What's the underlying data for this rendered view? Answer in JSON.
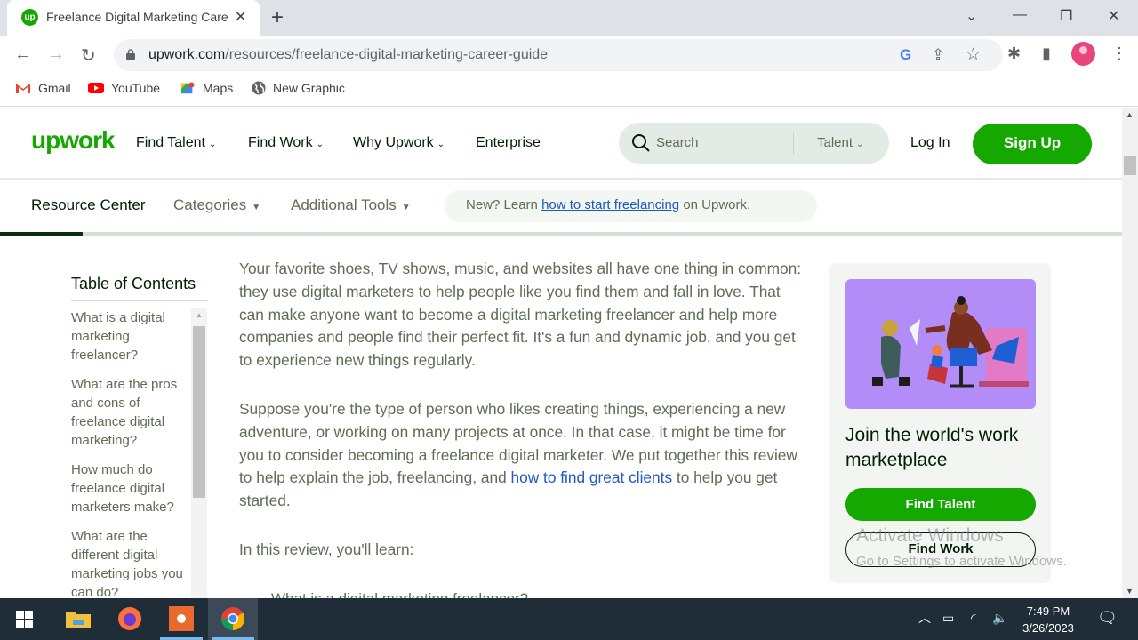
{
  "browser": {
    "tab": {
      "title": "Freelance Digital Marketing Care",
      "favicon": "up",
      "close": "✕"
    },
    "new_tab": "+",
    "window_controls": {
      "tab_search": "⌄",
      "minimize": "—",
      "restore": "❐",
      "close": "✕"
    },
    "url_host": "upwork.com",
    "url_path": "/resources/freelance-digital-marketing-career-guide",
    "nav": {
      "back": "←",
      "forward": "→",
      "reload": "↻"
    },
    "omnibox_icons": {
      "google": "G",
      "share": "⇪",
      "bookmark": "☆"
    },
    "toolbar_icons": {
      "extensions": "✱",
      "side_panel": "▮",
      "menu": "⋮"
    },
    "bookmarks": [
      {
        "label": "Gmail",
        "icon": "gmail-icon"
      },
      {
        "label": "YouTube",
        "icon": "youtube-icon"
      },
      {
        "label": "Maps",
        "icon": "maps-icon"
      },
      {
        "label": "New Graphic",
        "icon": "globe-icon"
      }
    ]
  },
  "header": {
    "logo": "upwork",
    "nav": [
      {
        "label": "Find Talent",
        "dropdown": true
      },
      {
        "label": "Find Work",
        "dropdown": true
      },
      {
        "label": "Why Upwork",
        "dropdown": true
      },
      {
        "label": "Enterprise",
        "dropdown": false
      }
    ],
    "search": {
      "placeholder": "Search",
      "scope": "Talent"
    },
    "login": "Log In",
    "signup": "Sign Up"
  },
  "subnav": {
    "resource_center": "Resource Center",
    "categories": "Categories",
    "additional_tools": "Additional Tools",
    "promo_prefix": "New? Learn ",
    "promo_link": "how to start freelancing",
    "promo_suffix": " on Upwork.",
    "reading_progress": 0.074
  },
  "toc": {
    "title": "Table of Contents",
    "items": [
      "What is a digital marketing freelancer?",
      "What are the pros and cons of freelance digital marketing?",
      "How much do freelance digital marketers make?",
      "What are the different digital marketing jobs you can do?"
    ]
  },
  "article": {
    "p1": "Your favorite shoes, TV shows, music, and websites all have one thing in common: they use digital marketers to help people like you find them and fall in love. That can make anyone want to become a digital marketing freelancer and help more companies and people find their perfect fit. It's a fun and dynamic job, and you get to experience new things regularly.",
    "p2_text": "Suppose you're the type of person who likes creating things, experiencing a new adventure, or working on many projects at once. In that case, it might be time for you to consider becoming a freelance digital marketer. We put together this review to help explain the job, freelancing, and ",
    "p2_link": "how to find great clients",
    "p2_tail": " to help you get started.",
    "p3": "In this review, you'll learn:",
    "list_first_item": "What is a digital marketing freelancer?"
  },
  "card": {
    "image": "illustration-people-working",
    "title": "Join the world's work marketplace",
    "find_talent": "Find Talent",
    "find_work": "Find Work"
  },
  "watermark": {
    "line1": "Activate Windows",
    "line2": "Go to Settings to activate Windows."
  },
  "taskbar": {
    "apps": [
      "windows-start",
      "file-explorer",
      "firefox",
      "screen-recorder",
      "chrome"
    ],
    "time": "7:49 PM",
    "date": "3/26/2023"
  },
  "colors": {
    "brand_green": "#14a800",
    "text_dark": "#001e00",
    "text_muted": "#5e6d55",
    "link_blue": "#1f57c3"
  }
}
